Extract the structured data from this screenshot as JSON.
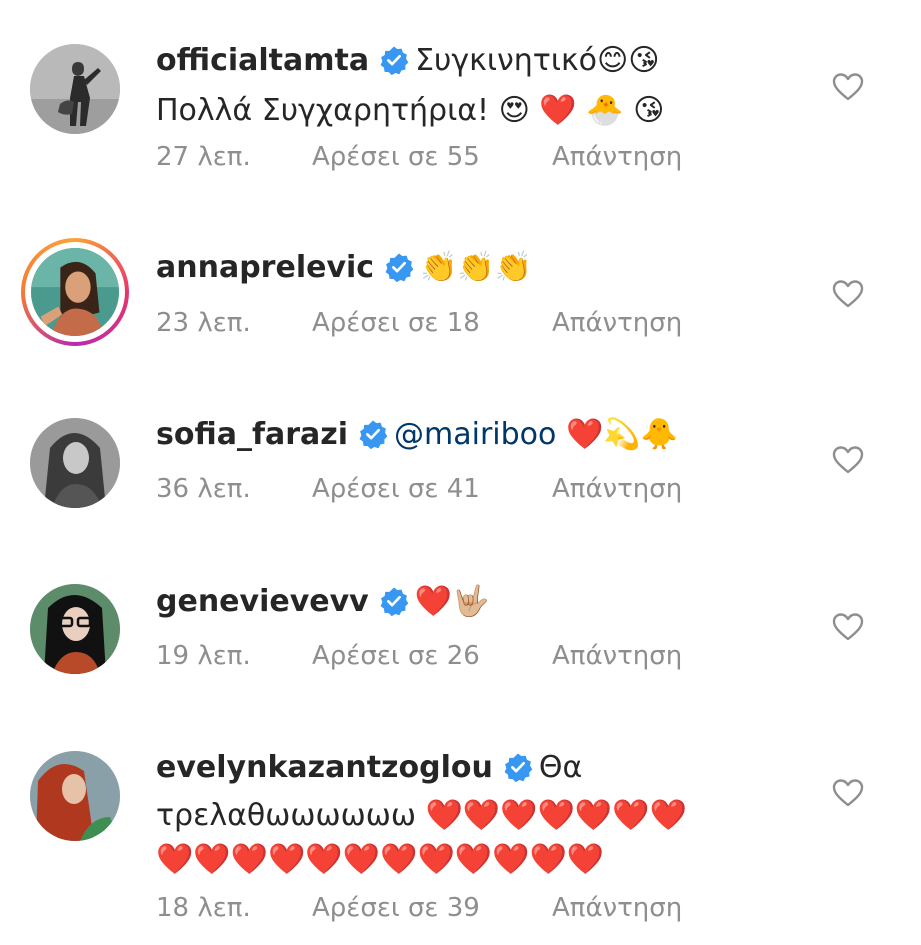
{
  "comments": [
    {
      "username": "officialtamta",
      "text_line1": "Συγκινητικό😊😘",
      "text_line2": "Πολλά Συγχαρητήρια! 😍 ❤️ 🐣 😘",
      "time": "27 λεπ.",
      "likes": "Αρέσει σε 55",
      "reply": "Απάντηση"
    },
    {
      "username": "annaprelevic",
      "text_line1": "👏👏👏",
      "time": "23 λεπ.",
      "likes": "Αρέσει σε 18",
      "reply": "Απάντηση"
    },
    {
      "username": "sofia_farazi",
      "mention": "@mairiboo",
      "text_line1": "❤️💫🐥",
      "time": "36 λεπ.",
      "likes": "Αρέσει σε 41",
      "reply": "Απάντηση"
    },
    {
      "username": "genevievevv",
      "text_line1": "❤️🤟🏼",
      "time": "19 λεπ.",
      "likes": "Αρέσει σε 26",
      "reply": "Απάντηση"
    },
    {
      "username": "evelynkazantzoglou",
      "text_line1": "Θα",
      "text_line2": "τρελαθωωωωωω ❤️❤️❤️❤️❤️❤️❤️",
      "text_line3": "❤️❤️❤️❤️❤️❤️❤️❤️❤️❤️❤️❤️",
      "time": "18 λεπ.",
      "likes": "Αρέσει σε 39",
      "reply": "Απάντηση"
    }
  ],
  "colors": {
    "verified_blue": "#3897f0",
    "meta_gray": "#8e8e8e",
    "mention_blue": "#00376b",
    "heart_red": "#e0202e"
  },
  "icons": {
    "verified": "verified-badge-icon",
    "like": "heart-outline-icon"
  }
}
